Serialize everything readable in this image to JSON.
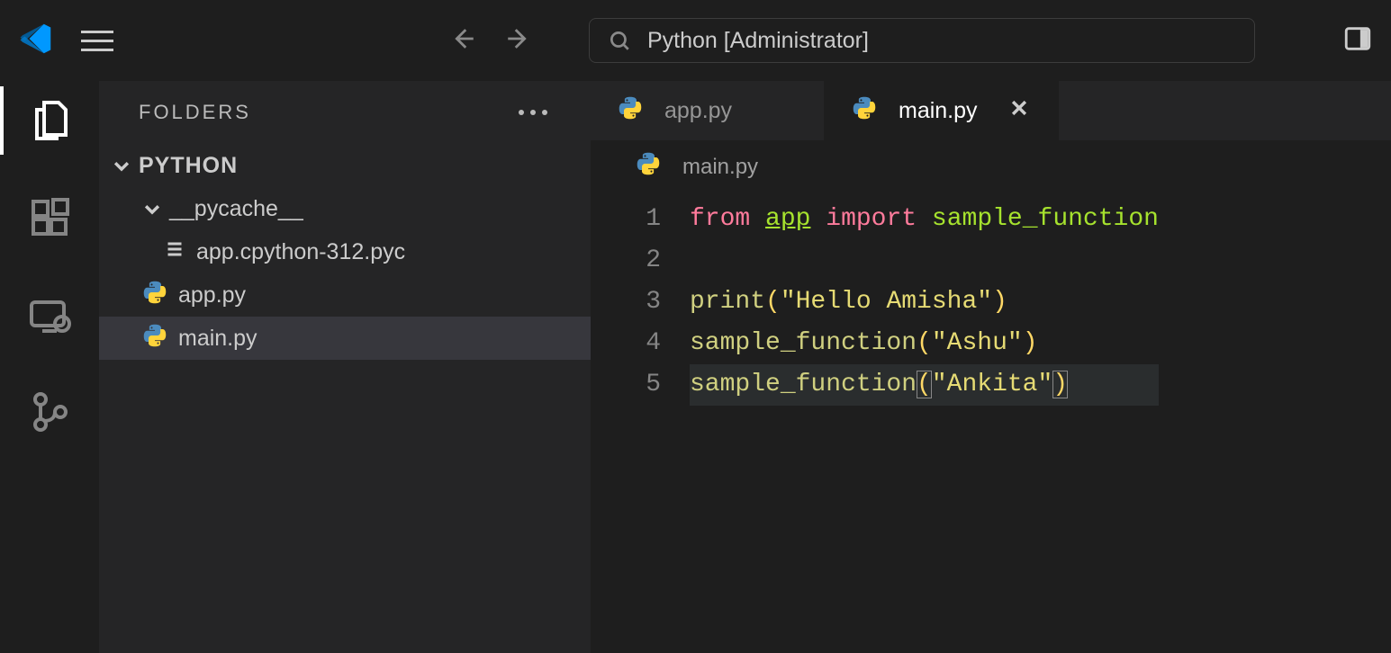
{
  "titlebar": {
    "search_text": "Python [Administrator]"
  },
  "sidebar": {
    "title": "FOLDERS",
    "root": "PYTHON",
    "pycache_folder": "__pycache__",
    "pyc_file": "app.cpython-312.pyc",
    "file_app": "app.py",
    "file_main": "main.py"
  },
  "tabs": {
    "app": "app.py",
    "main": "main.py"
  },
  "breadcrumb": {
    "file": "main.py"
  },
  "gutter": {
    "l1": "1",
    "l2": "2",
    "l3": "3",
    "l4": "4",
    "l5": "5"
  },
  "code": {
    "kw_from": "from",
    "mod_app": "app",
    "kw_import": "import",
    "fn_sample": "sample_function",
    "call_print": "print",
    "call_sample": "sample_function",
    "str_hello": "\"Hello Amisha\"",
    "str_ashu": "\"Ashu\"",
    "str_ankita": "\"Ankita\"",
    "lp": "(",
    "rp": ")"
  }
}
